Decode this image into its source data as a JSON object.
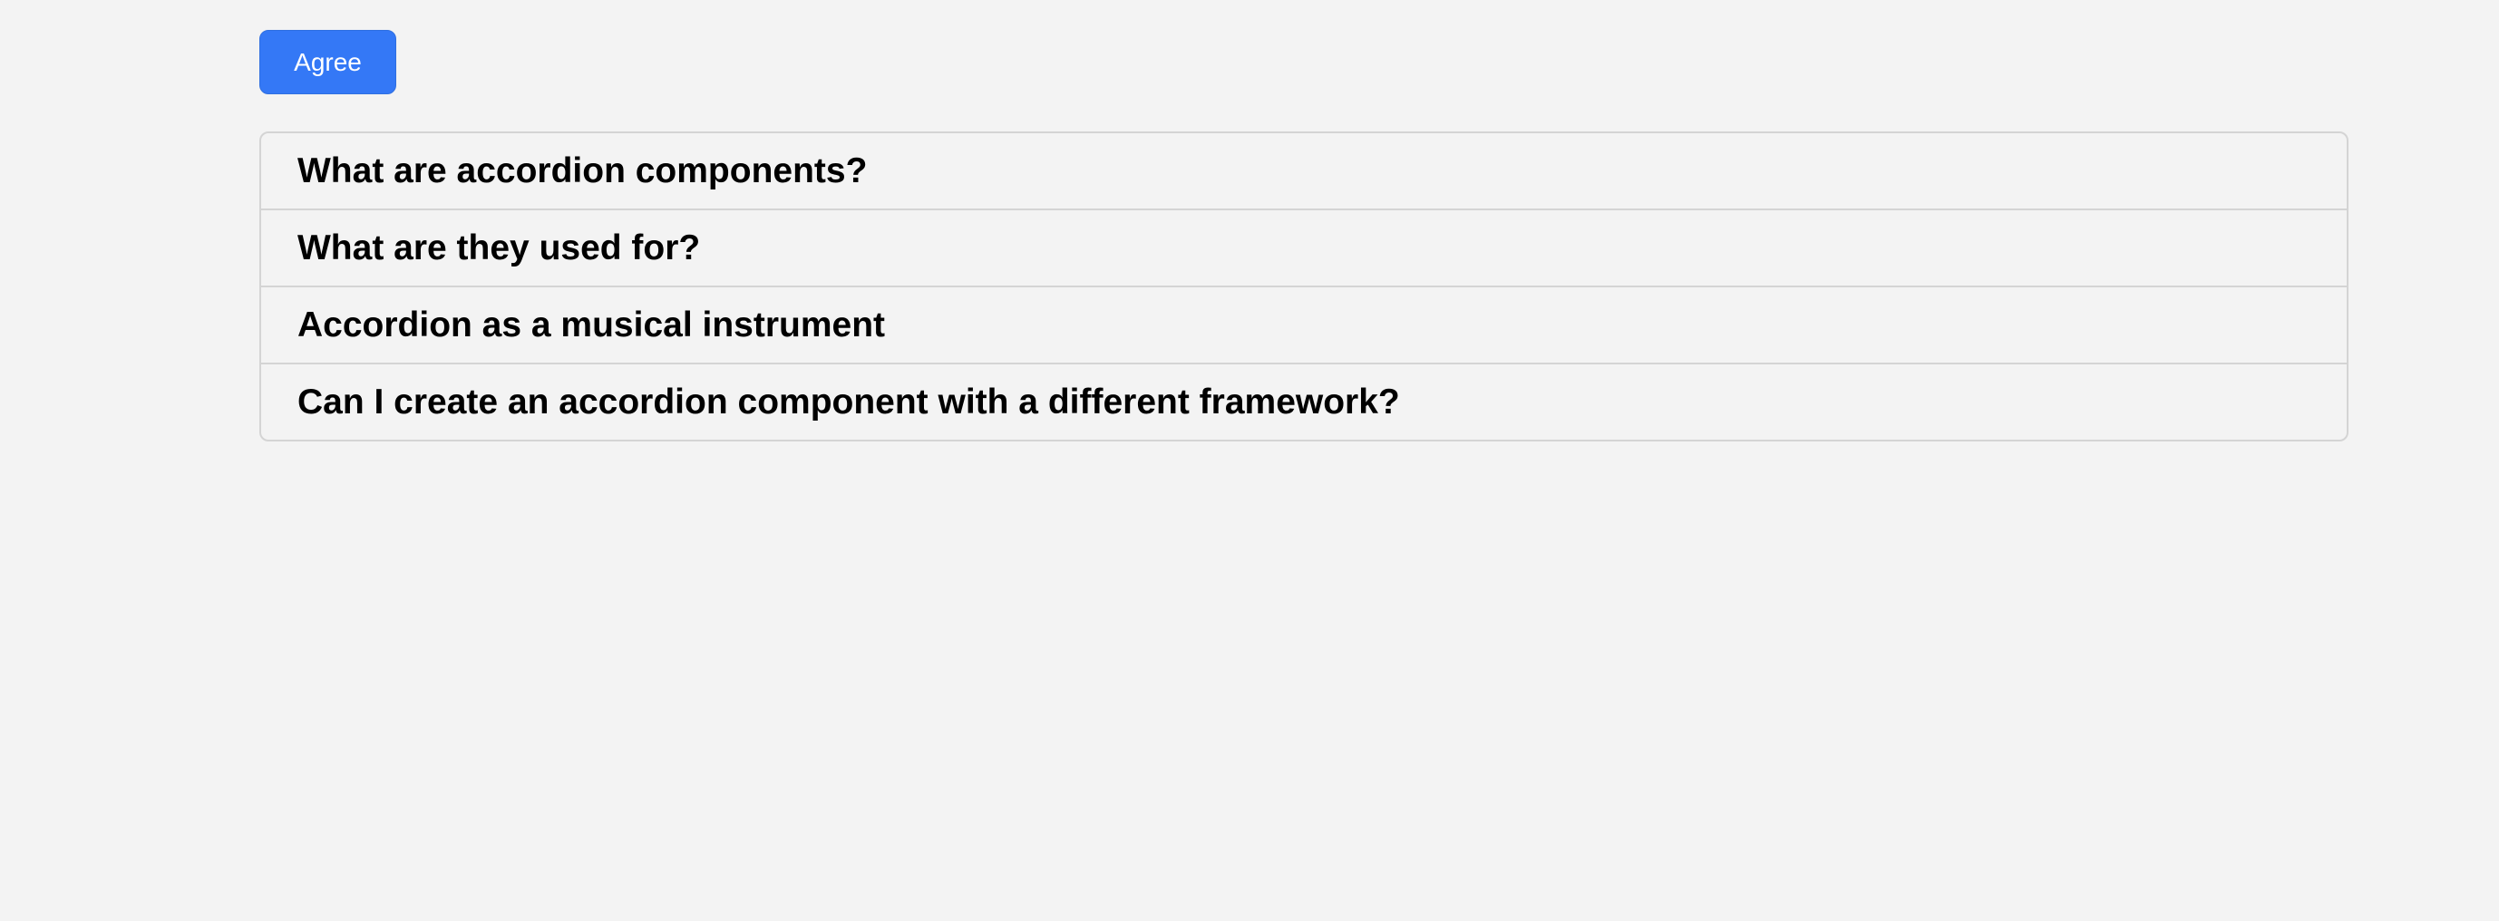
{
  "agree_button": {
    "label": "Agree",
    "color": "#3478f6"
  },
  "accordion": {
    "items": [
      {
        "label": "What are accordion components?"
      },
      {
        "label": "What are they used for?"
      },
      {
        "label": "Accordion as a musical instrument"
      },
      {
        "label": "Can I create an accordion component with a different framework?"
      }
    ]
  }
}
